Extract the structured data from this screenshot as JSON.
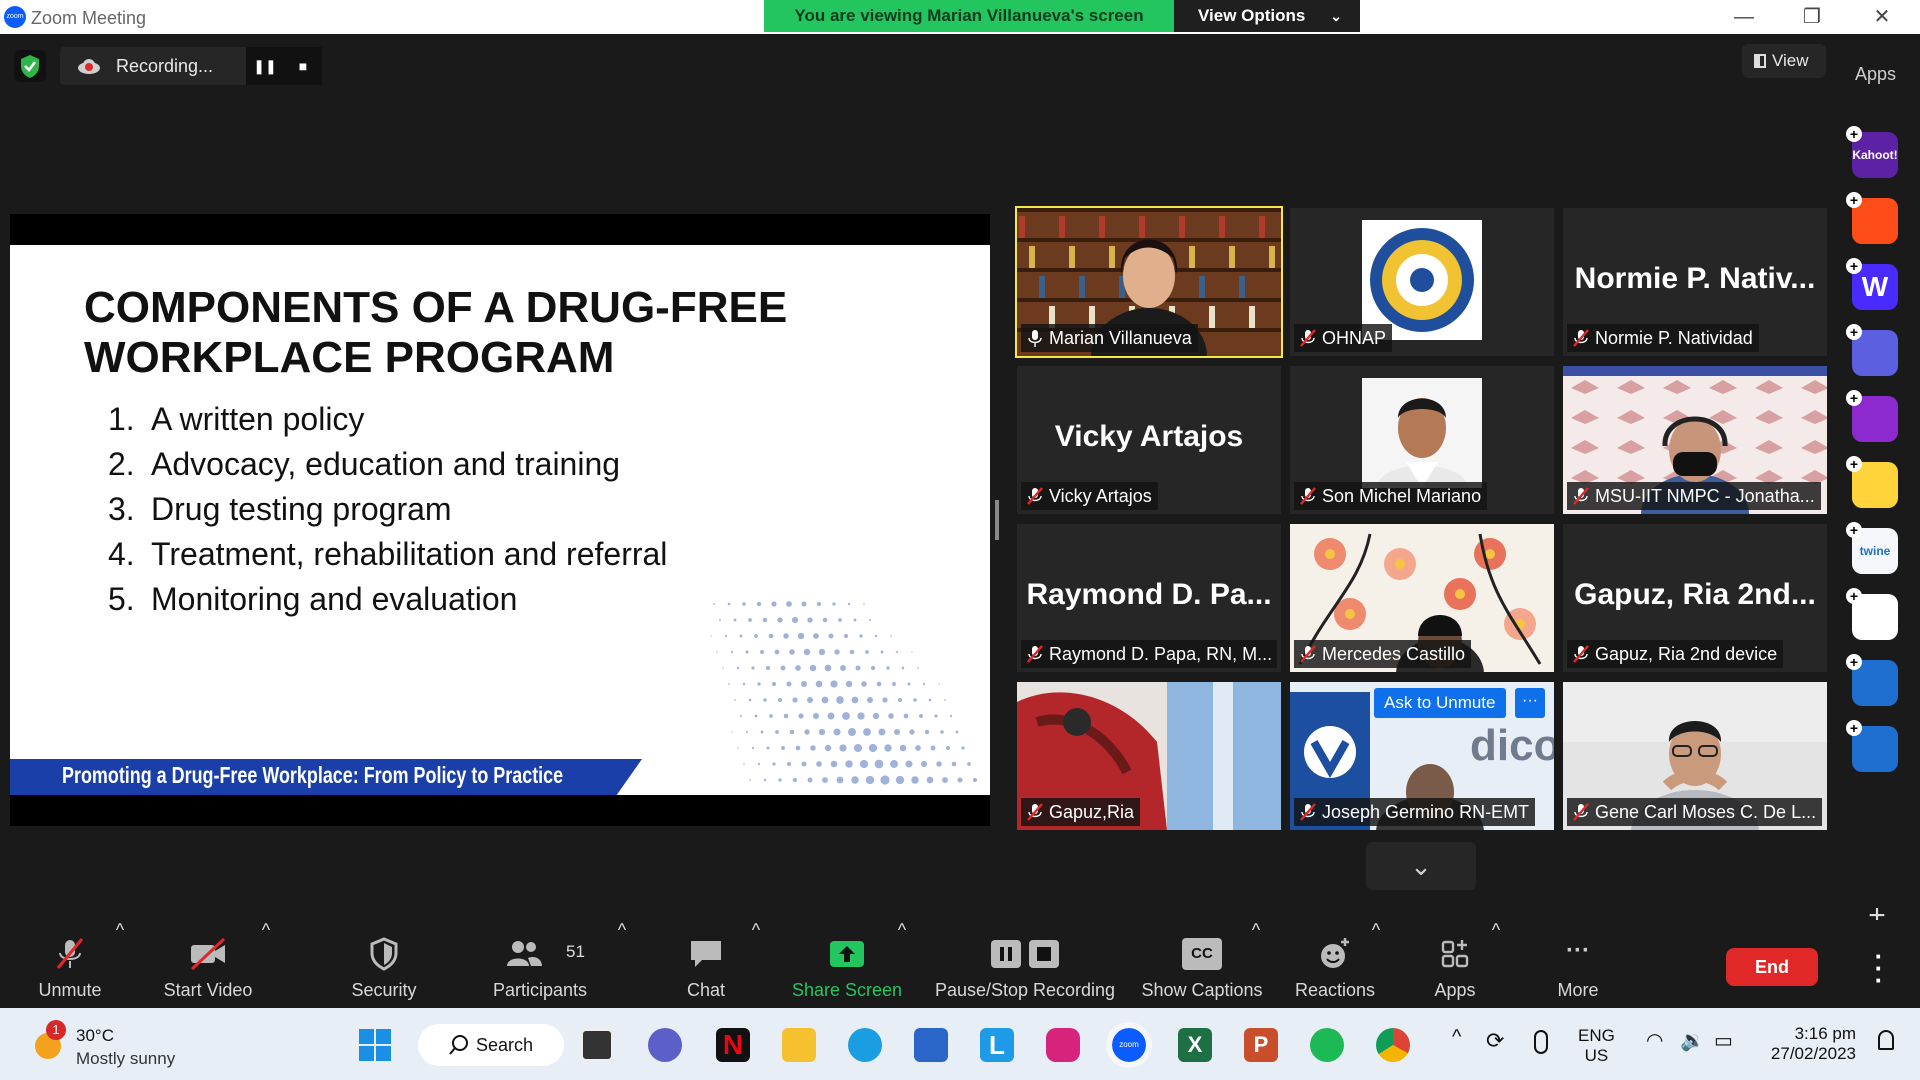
{
  "window": {
    "title": "Zoom Meeting",
    "banner": "You are viewing Marian Villanueva's screen",
    "view_options": "View Options",
    "minimize": "—",
    "restore": "❐",
    "close": "✕"
  },
  "recording": {
    "status": "Recording...",
    "pause": "❚❚",
    "stop": "■"
  },
  "view_button": "View",
  "apps_panel_title": "Apps",
  "slide": {
    "title": "COMPONENTS OF A DRUG-FREE WORKPLACE PROGRAM",
    "items": [
      {
        "num": "1.",
        "text": "A written policy"
      },
      {
        "num": "2.",
        "text": "Advocacy, education and training"
      },
      {
        "num": "3.",
        "text": "Drug testing program"
      },
      {
        "num": "4.",
        "text": "Treatment, rehabilitation and referral"
      },
      {
        "num": "5.",
        "text": "Monitoring and evaluation"
      }
    ],
    "footer": "Promoting a Drug-Free Workplace: From Policy to Practice"
  },
  "participants": [
    {
      "label": "Marian Villanueva",
      "bigname": "",
      "kind": "video-library",
      "active": true,
      "mic": "speaker"
    },
    {
      "label": "OHNAP",
      "bigname": "",
      "kind": "logo",
      "active": false,
      "mic": "muted"
    },
    {
      "label": "Normie P. Natividad",
      "bigname": "Normie P. Nativ...",
      "kind": "name",
      "active": false,
      "mic": "muted"
    },
    {
      "label": "Vicky Artajos",
      "bigname": "Vicky Artajos",
      "kind": "name",
      "active": false,
      "mic": "muted"
    },
    {
      "label": "Son Michel Mariano",
      "bigname": "",
      "kind": "portrait",
      "active": false,
      "mic": "muted"
    },
    {
      "label": "MSU-IIT NMPC - Jonatha...",
      "bigname": "",
      "kind": "video-mask",
      "active": false,
      "mic": "muted"
    },
    {
      "label": "Raymond D. Papa, RN, M...",
      "bigname": "Raymond D. Pa...",
      "kind": "name",
      "active": false,
      "mic": "muted"
    },
    {
      "label": "Mercedes Castillo",
      "bigname": "",
      "kind": "video-floral",
      "active": false,
      "mic": "muted"
    },
    {
      "label": "Gapuz, Ria 2nd device",
      "bigname": "Gapuz, Ria 2nd...",
      "kind": "name",
      "active": false,
      "mic": "muted"
    },
    {
      "label": "Gapuz,Ria",
      "bigname": "",
      "kind": "video-red",
      "active": false,
      "mic": "muted"
    },
    {
      "label": "Joseph Germino RN-EMT",
      "bigname": "",
      "kind": "video-banner",
      "active": false,
      "mic": "muted"
    },
    {
      "label": "Gene Carl Moses C. De L...",
      "bigname": "",
      "kind": "video-man",
      "active": false,
      "mic": "muted"
    }
  ],
  "ask_to_unmute": "Ask to Unmute",
  "more_dots": "···",
  "scroll_down": "⌄",
  "toolbar": {
    "unmute": "Unmute",
    "start_video": "Start Video",
    "security": "Security",
    "participants": "Participants",
    "participant_count": "51",
    "chat": "Chat",
    "share_screen": "Share Screen",
    "pause_stop_recording": "Pause/Stop Recording",
    "show_captions": "Show Captions",
    "cc": "CC",
    "reactions": "Reactions",
    "apps": "Apps",
    "more": "More",
    "end": "End"
  },
  "apps_list": [
    {
      "name": "Kahoot!",
      "short": "Kahoot!"
    },
    {
      "name": "Class",
      "short": ""
    },
    {
      "name": "Wooclap",
      "short": "W"
    },
    {
      "name": "Poll app",
      "short": ""
    },
    {
      "name": "Gallery app",
      "short": ""
    },
    {
      "name": "Emoji app",
      "short": ""
    },
    {
      "name": "twine",
      "short": "twine"
    },
    {
      "name": "Grid app",
      "short": ""
    },
    {
      "name": "Refresh app",
      "short": ""
    },
    {
      "name": "Edu app",
      "short": ""
    },
    {
      "name": "Leaf app",
      "short": ""
    },
    {
      "name": "Screen app",
      "short": ""
    }
  ],
  "apps_add": "+",
  "taskbar": {
    "weather_badge": "1",
    "weather_temp": "30°C",
    "weather_desc": "Mostly sunny",
    "search": "Search",
    "lang_top": "ENG",
    "lang_bottom": "US",
    "time": "3:16 pm",
    "date": "27/02/2023"
  },
  "colors": {
    "banner_green": "#22c55e",
    "end_red": "#e02828",
    "active_speaker": "#f5e84a",
    "zoom_blue": "#0e71eb",
    "share_green": "#22c55e"
  }
}
